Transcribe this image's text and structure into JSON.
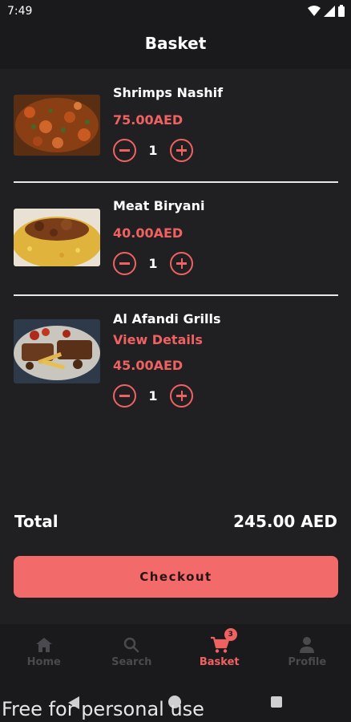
{
  "status_bar": {
    "time": "7:49"
  },
  "header": {
    "title": "Basket"
  },
  "items": [
    {
      "name": "Shrimps Nashif",
      "link": "",
      "price": "75.00AED",
      "quantity": "1"
    },
    {
      "name": "Meat Biryani",
      "link": "",
      "price": "40.00AED",
      "quantity": "1"
    },
    {
      "name": "Al Afandi Grills",
      "link": "View Details",
      "price": "45.00AED",
      "quantity": "1"
    }
  ],
  "summary": {
    "total_label": "Total",
    "total_value": "245.00 AED"
  },
  "checkout": {
    "label": "Checkout"
  },
  "bottom_nav": {
    "items": [
      {
        "label": "Home",
        "icon": "home-icon"
      },
      {
        "label": "Search",
        "icon": "search-icon"
      },
      {
        "label": "Basket",
        "icon": "cart-icon",
        "badge": "3",
        "active": true
      },
      {
        "label": "Profile",
        "icon": "person-icon"
      }
    ]
  },
  "watermark": "Free for personal use",
  "colors": {
    "accent": "#f06262",
    "background": "#202023",
    "bar": "#1a1a1c"
  }
}
